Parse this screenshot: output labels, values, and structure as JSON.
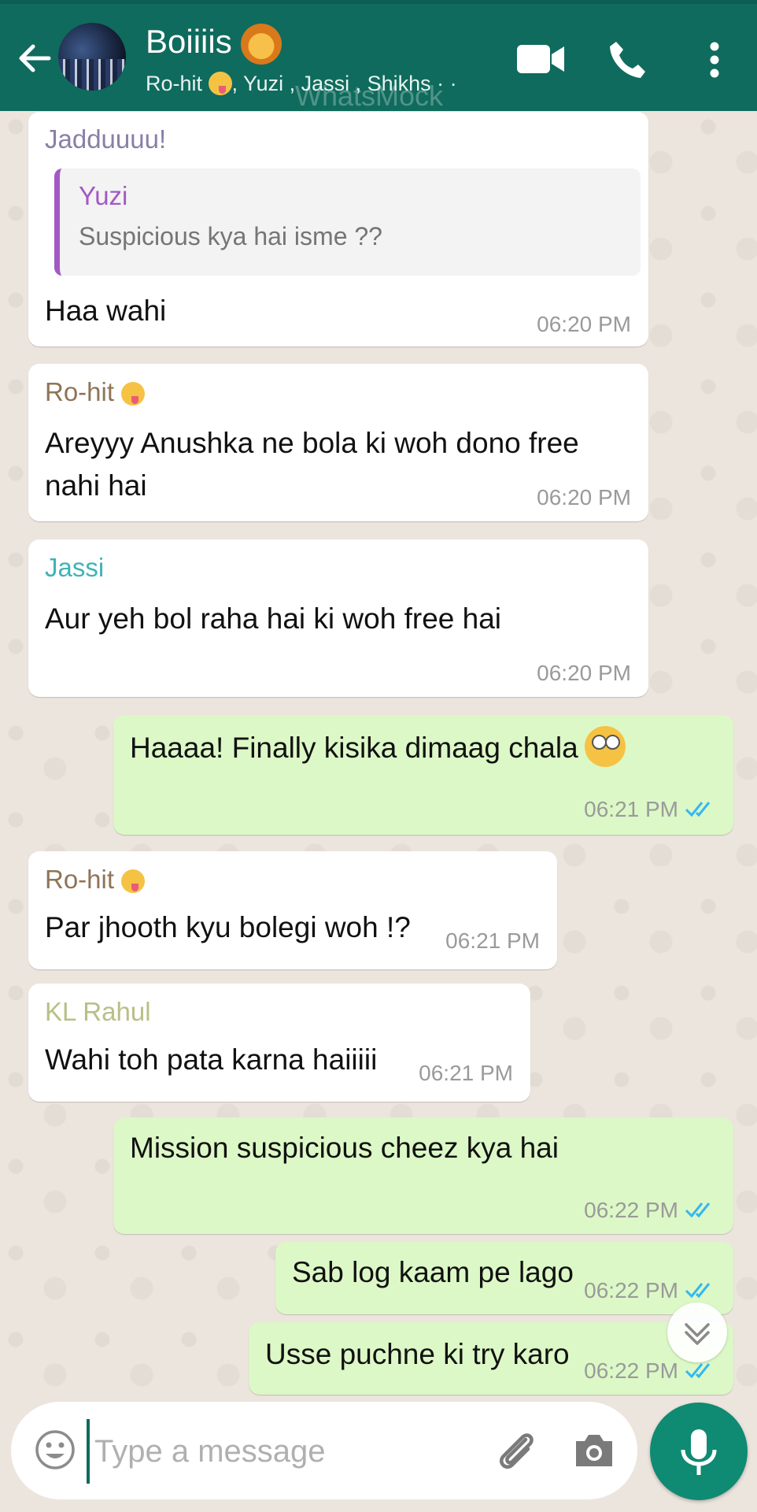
{
  "header": {
    "title": "Boiiiis",
    "members": [
      "Ro-hit",
      ", Yuzi , Jassi , Shikhs · ·"
    ],
    "watermark": "WhatsMock"
  },
  "colors": {
    "header_bg": "#0f6b5d",
    "incoming_bubble": "#ffffff",
    "outgoing_bubble": "#dcf8c6",
    "read_ticks": "#34b7f1",
    "mic_button": "#0f8a73"
  },
  "messages": [
    {
      "dir": "in",
      "sender": "Jadduuuu!",
      "sender_color": "#8a7fa6",
      "quote": {
        "name": "Yuzi",
        "text": "Suspicious kya hai isme ??"
      },
      "text": "Haa wahi",
      "time": "06:20 PM"
    },
    {
      "dir": "in",
      "sender": "Ro-hit",
      "sender_color": "#8f7456",
      "text": "Areyyy Anushka ne bola ki woh dono free nahi hai",
      "time": "06:20 PM"
    },
    {
      "dir": "in",
      "sender": "Jassi",
      "sender_color": "#3fb3b6",
      "text": "Aur yeh bol raha hai ki woh free hai",
      "time": "06:20 PM"
    },
    {
      "dir": "out",
      "text": "Haaaa! Finally kisika dimaag chala",
      "time": "06:21 PM",
      "read": true
    },
    {
      "dir": "in",
      "sender": "Ro-hit",
      "sender_color": "#8f7456",
      "text": "Par jhooth kyu bolegi woh !?",
      "time": "06:21 PM"
    },
    {
      "dir": "in",
      "sender": "KL Rahul",
      "sender_color": "#b8bf86",
      "text": "Wahi toh pata karna haiiiii",
      "time": "06:21 PM"
    },
    {
      "dir": "out",
      "text": "Mission suspicious cheez kya hai",
      "time": "06:22 PM",
      "read": true
    },
    {
      "dir": "out",
      "text": "Sab log kaam pe lago",
      "time": "06:22 PM",
      "read": true
    },
    {
      "dir": "out",
      "text": "Usse puchne ki try karo",
      "time": "06:22 PM",
      "read": true
    }
  ],
  "composer": {
    "placeholder": "Type a message"
  },
  "icons": [
    "back-arrow-icon",
    "video-call-icon",
    "phone-icon",
    "more-options-icon",
    "lion-face-icon",
    "emoji-icon",
    "paperclip-icon",
    "camera-icon",
    "microphone-icon",
    "chevron-double-down-icon",
    "double-check-icon"
  ]
}
